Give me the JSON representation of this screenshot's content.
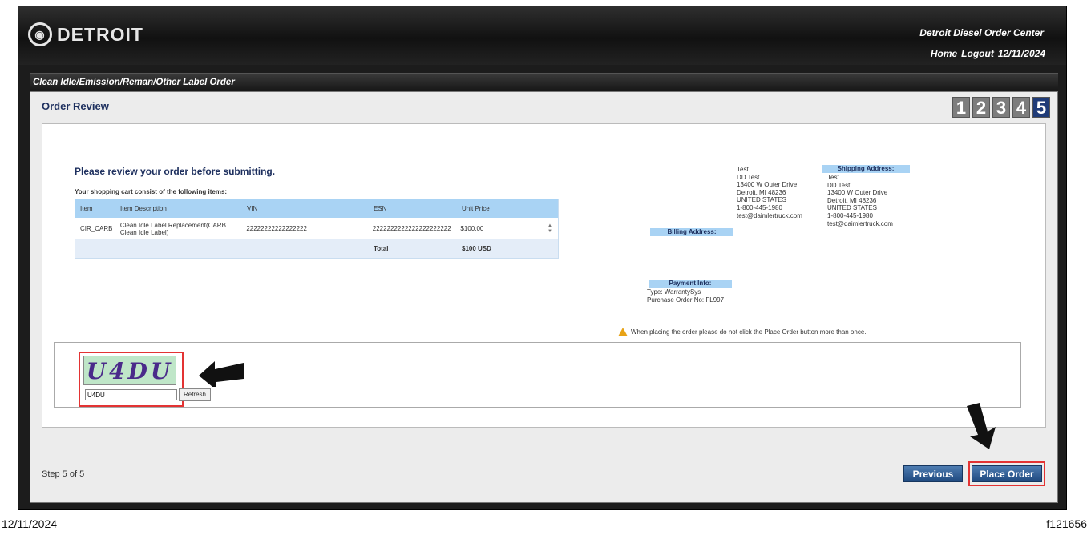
{
  "header": {
    "logo_text": "DETROIT",
    "app_title": "Detroit Diesel Order Center",
    "nav": {
      "home": "Home",
      "logout": "Logout",
      "date": "12/11/2024"
    }
  },
  "section_title": "Clean Idle/Emission/Reman/Other Label Order",
  "panel": {
    "title": "Order Review",
    "steps": [
      "1",
      "2",
      "3",
      "4",
      "5"
    ],
    "active_step": "5"
  },
  "review": {
    "message": "Please review your order before submitting.",
    "cart_label": "Your shopping cart consist of the following items:",
    "columns": [
      "Item",
      "Item Description",
      "VIN",
      "ESN",
      "Unit Price"
    ],
    "rows": [
      {
        "item": "CIR_CARB",
        "description": "Clean Idle Label Replacement(CARB Clean Idle Label)",
        "vin": "22222222222222222",
        "esn": "2222222222222222222222",
        "price": "$100.00"
      }
    ],
    "total_label": "Total",
    "total_value": "$100 USD"
  },
  "billing": {
    "header": "Billing Address:",
    "lines": [
      "Test",
      "DD Test",
      "13400 W Outer Drive",
      "Detroit, MI 48236",
      "UNITED STATES",
      "1-800-445-1980",
      "test@daimlertruck.com"
    ]
  },
  "shipping": {
    "header": "Shipping Address:",
    "lines": [
      "Test",
      "DD Test",
      "13400 W Outer Drive",
      "Detroit, MI 48236",
      "UNITED STATES",
      "1-800-445-1980",
      "test@daimlertruck.com"
    ]
  },
  "payment": {
    "header": "Payment Info:",
    "type": "Type: WarrantySys",
    "po": "Purchase Order No: FL997"
  },
  "warning": "When placing the order please do not click the Place Order button more than once.",
  "captcha": {
    "image_text": "U4DU",
    "input_value": "U4DU",
    "refresh_label": "Refresh"
  },
  "footer": {
    "step_text": "Step 5 of 5",
    "previous_label": "Previous",
    "place_order_label": "Place Order"
  },
  "page_footer": {
    "date": "12/11/2024",
    "figure_id": "f121656"
  },
  "colors": {
    "accent": "#1f3b78",
    "highlight": "#e33333",
    "table_header": "#a9d3f4"
  }
}
